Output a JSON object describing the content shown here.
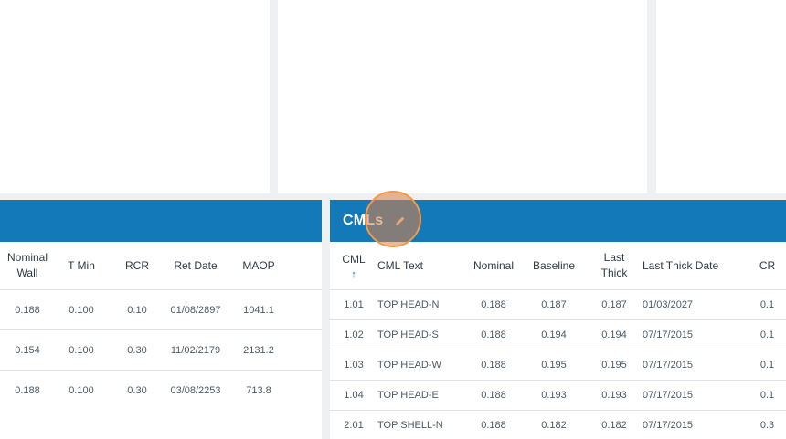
{
  "left_panel": {
    "columns": [
      {
        "key": "nominal_wall",
        "label_lines": [
          "Nominal",
          "Wall"
        ]
      },
      {
        "key": "t_min",
        "label_lines": [
          "T Min",
          ""
        ]
      },
      {
        "key": "rcr",
        "label_lines": [
          "RCR",
          ""
        ]
      },
      {
        "key": "ret_date",
        "label_lines": [
          "Ret Date",
          ""
        ]
      },
      {
        "key": "maop",
        "label_lines": [
          "MAOP",
          ""
        ]
      }
    ],
    "rows": [
      [
        "0.188",
        "0.100",
        "0.10",
        "01/08/2897",
        "1041.1"
      ],
      [
        "0.154",
        "0.100",
        "0.30",
        "11/02/2179",
        "2131.2"
      ],
      [
        "0.188",
        "0.100",
        "0.30",
        "03/08/2253",
        "713.8"
      ]
    ]
  },
  "right_panel": {
    "title": "CMLs",
    "edit_icon": "pencil-icon",
    "sort_arrow": "↑",
    "columns": [
      {
        "key": "cml",
        "label_lines": [
          "CML",
          ""
        ]
      },
      {
        "key": "cml_text",
        "label_lines": [
          "CML Text",
          ""
        ]
      },
      {
        "key": "nominal",
        "label_lines": [
          "Nominal",
          ""
        ]
      },
      {
        "key": "baseline",
        "label_lines": [
          "Baseline",
          ""
        ]
      },
      {
        "key": "last_thick",
        "label_lines": [
          "Last",
          "Thick"
        ]
      },
      {
        "key": "last_thick_date",
        "label_lines": [
          "Last Thick Date",
          ""
        ]
      },
      {
        "key": "cr",
        "label_lines": [
          "CR",
          ""
        ]
      }
    ],
    "rows": [
      [
        "1.01",
        "TOP HEAD-N",
        "0.188",
        "0.187",
        "0.187",
        "01/03/2027",
        "0.1"
      ],
      [
        "1.02",
        "TOP HEAD-S",
        "0.188",
        "0.194",
        "0.194",
        "07/17/2015",
        "0.1"
      ],
      [
        "1.03",
        "TOP HEAD-W",
        "0.188",
        "0.195",
        "0.195",
        "07/17/2015",
        "0.1"
      ],
      [
        "1.04",
        "TOP HEAD-E",
        "0.188",
        "0.193",
        "0.193",
        "07/17/2015",
        "0.1"
      ],
      [
        "2.01",
        "TOP SHELL-N",
        "0.188",
        "0.182",
        "0.182",
        "07/17/2015",
        "0.3"
      ]
    ]
  },
  "colors": {
    "header_blue": "#1479b8",
    "cursor_orange": "#f29a47"
  }
}
